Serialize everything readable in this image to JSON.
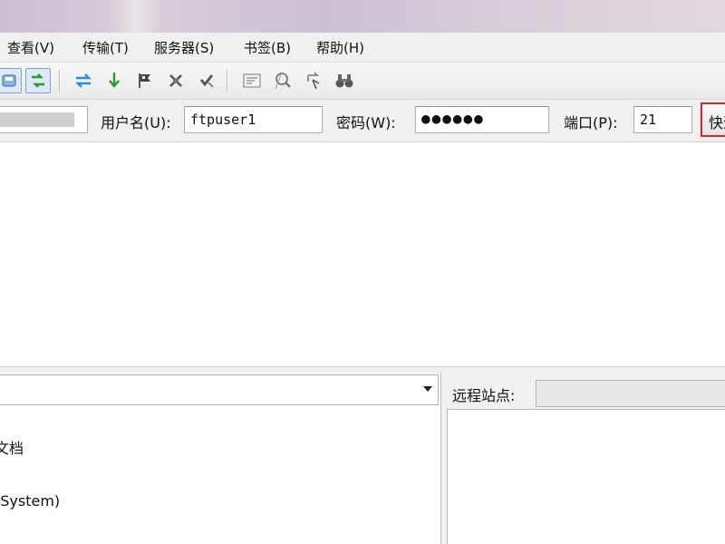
{
  "menu": [
    {
      "id": "view",
      "label": "查看(V)"
    },
    {
      "id": "transfer",
      "label": "传输(T)"
    },
    {
      "id": "server",
      "label": "服务器(S)"
    },
    {
      "id": "bookmarks",
      "label": "书签(B)"
    },
    {
      "id": "help",
      "label": "帮助(H)"
    }
  ],
  "toolbar_icons": [
    "site-manager-icon",
    "toggle-panes-icon",
    "process-queue-icon",
    "reconnect-download-icon",
    "flag-icon",
    "disconnect-icon",
    "cancel-icon",
    "filter-icon",
    "compare-icon",
    "sync-browse-icon",
    "search-binoculars-icon"
  ],
  "quickconnect": {
    "username_label": "用户名(U):",
    "username_value": "ftpuser1",
    "password_label": "密码(W):",
    "password_value": "●●●●●●",
    "port_label": "端口(P):",
    "port_value": "21",
    "connect_label": "快速连接(Q)"
  },
  "local_tree": [
    {
      "label": "文档"
    },
    {
      "label": "(System)"
    }
  ],
  "remote": {
    "label": "远程站点:"
  },
  "colors": {
    "highlight": "#e0262b",
    "pressed_bg": "#dce9f7",
    "green_arrow": "#2a9a2a"
  }
}
